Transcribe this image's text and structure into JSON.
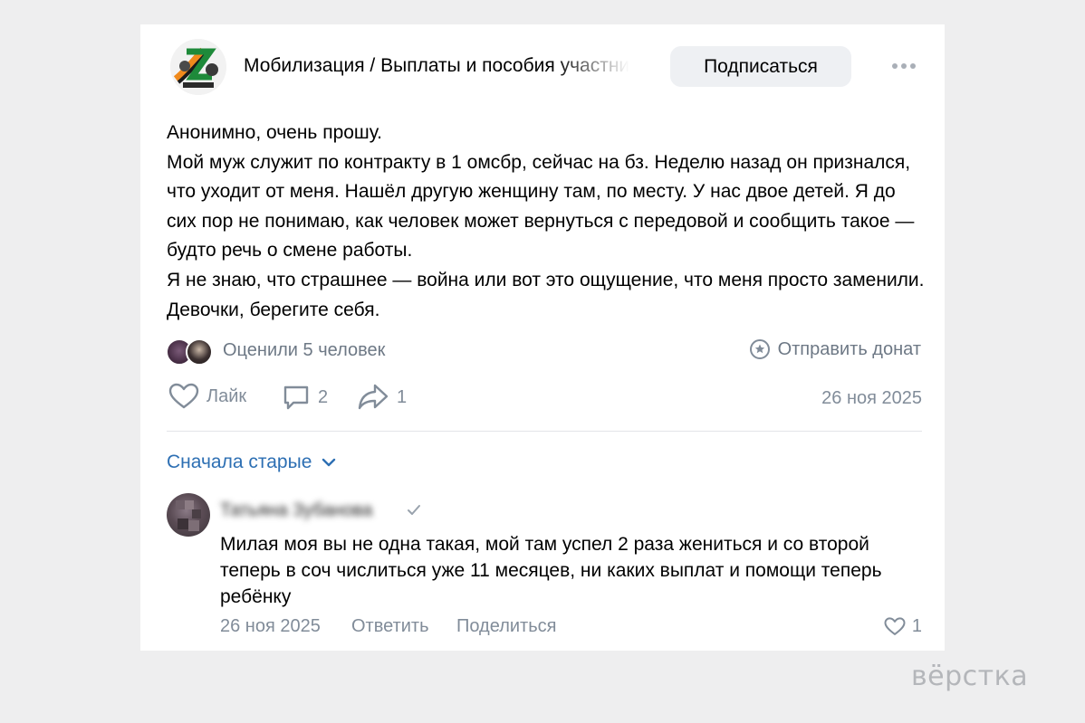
{
  "group": {
    "name": "Мобилизация / Выплаты и пособия участникам",
    "avatar_icon": "z-logo-icon",
    "subscribe_label": "Подписаться"
  },
  "post": {
    "paragraphs": [
      "Анонимно, очень прошу.",
      "Мой муж служит по контракту в 1 омсбр, сейчас на бз. Неделю назад он признался, что уходит от меня. Нашёл другую женщину там, по месту. У нас двое детей. Я до сих пор не понимаю, как человек может вернуться с передовой и сообщить такое — будто речь о смене работы.",
      "Я не знаю, что страшнее — война или вот это ощущение, что меня просто заменили. Девочки, берегите себя."
    ],
    "liked_by_label": "Оценили 5 человек",
    "donate_label": "Отправить донат",
    "like_label": "Лайк",
    "comments_count": "2",
    "shares_count": "1",
    "date": "26 ноя 2025"
  },
  "comments_section": {
    "sort_label": "Сначала старые"
  },
  "comment": {
    "author": "Татьяна Зубанова",
    "text": "Милая моя вы не одна такая, мой там успел 2 раза жениться и со второй теперь в соч числиться уже 11 месяцев, ни каких выплат и помощи теперь ребёнку",
    "date": "26 ноя 2025",
    "reply_label": "Ответить",
    "share_label": "Поделиться",
    "likes_count": "1"
  },
  "watermark": "вёрстка",
  "colors": {
    "accent": "#2d6fb3",
    "secondary_text": "#818c99",
    "button_bg": "#eef0f3",
    "page_bg": "#eeeeef"
  }
}
